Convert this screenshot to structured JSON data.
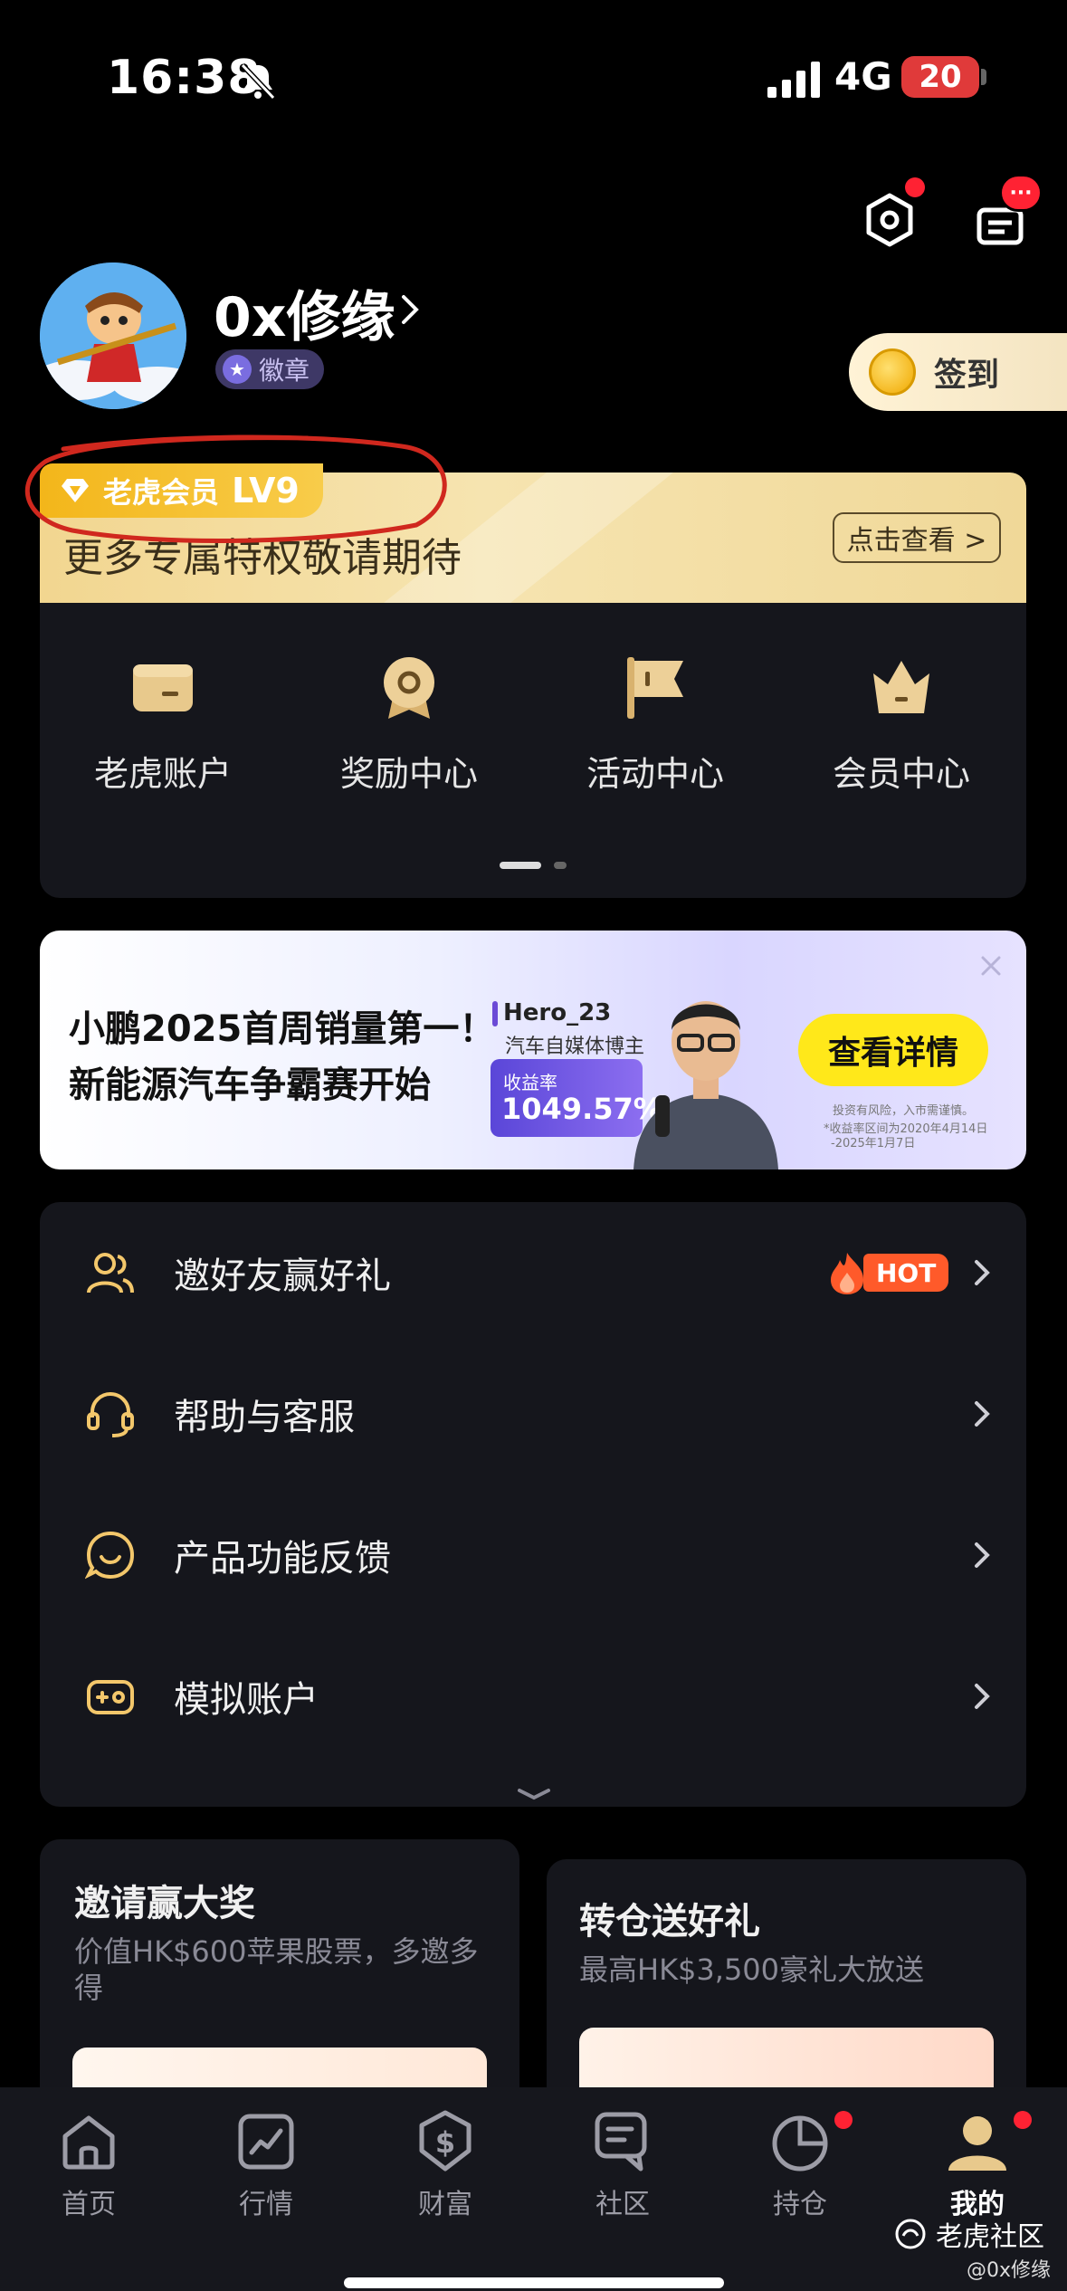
{
  "status_bar": {
    "time": "16:38",
    "network": "4G",
    "battery": "20"
  },
  "profile": {
    "username": "0x修缘",
    "badge": "徽章",
    "checkin_label": "签到"
  },
  "message_badge": "···",
  "member": {
    "label": "老虎会员",
    "level": "LV9",
    "subtitle": "更多专属特权敬请期待",
    "view_button": "点击查看 >"
  },
  "shortcuts": [
    {
      "label": "老虎账户"
    },
    {
      "label": "奖励中心"
    },
    {
      "label": "活动中心"
    },
    {
      "label": "会员中心"
    }
  ],
  "ad": {
    "line1": "小鹏2025首周销量第一！",
    "line2": "新能源汽车争霸赛开始",
    "name": "Hero_23",
    "role": "汽车自媒体博主",
    "return_label": "收益率",
    "return_value": "1049.57%",
    "cta": "查看详情",
    "risk": "投资有风险，入市需谨慎。",
    "note1": "*收益率区间为2020年4月14日",
    "note2": "-2025年1月7日"
  },
  "menu": [
    {
      "label": "邀好友赢好礼",
      "hot": "HOT"
    },
    {
      "label": "帮助与客服"
    },
    {
      "label": "产品功能反馈"
    },
    {
      "label": "模拟账户"
    }
  ],
  "promos": [
    {
      "title": "邀请赢大奖",
      "subtitle": "价值HK$600苹果股票，多邀多得"
    },
    {
      "title": "转仓送好礼",
      "subtitle": "最高HK$3,500豪礼大放送"
    }
  ],
  "tabs": [
    {
      "label": "首页"
    },
    {
      "label": "行情"
    },
    {
      "label": "财富"
    },
    {
      "label": "社区"
    },
    {
      "label": "持仓"
    },
    {
      "label": "我的"
    }
  ],
  "watermark": {
    "brand": "老虎社区",
    "handle": "@0x修缘"
  },
  "colors": {
    "gold": "#f3c76b",
    "hot": "#ff5a2a",
    "cta": "#ffe81a",
    "alert": "#ff2233",
    "annotation": "#d0281e"
  }
}
